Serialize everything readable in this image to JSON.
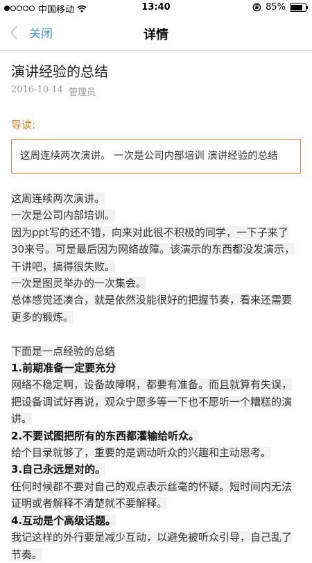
{
  "status": {
    "carrier": "中国移动",
    "time": "13:40",
    "battery": "85%"
  },
  "nav": {
    "back_label": "关闭",
    "title": "详情"
  },
  "article": {
    "title": "演讲经验的总结",
    "date": "2016-10-14",
    "author": "管理员",
    "guide_label": "导读:",
    "guide_text": "这周连续两次演讲。 一次是公司内部培训 演讲经验的总结",
    "lines": [
      {
        "text": "这周连续两次演讲。",
        "bold": false
      },
      {
        "text": "一次是公司内部培训。",
        "bold": false
      },
      {
        "text": "因为ppt写的还不错，向来对此很不积极的同学，一下子来了30来号。可是最后因为网络故障。该演示的东西都没发演示，干讲吧，搞得很失败。",
        "bold": false
      },
      {
        "text": "一次是图灵举办的一次集会。",
        "bold": false
      },
      {
        "text": "总体感觉还凑合，就是依然没能很好的把握节奏，看来还需要更多的锻炼。",
        "bold": false
      },
      {
        "text": "",
        "bold": false
      },
      {
        "text": "下面是一点经验的总结",
        "bold": false
      },
      {
        "text": "1.前期准备一定要充分",
        "bold": true
      },
      {
        "text": "网络不稳定啊，设备故障啊，都要有准备。而且就算有失误，把设备调试好再说，观众宁愿多等一下也不愿听一个糟糕的演讲。",
        "bold": false
      },
      {
        "text": "2.不要试图把所有的东西都灌输给听众。",
        "bold": true
      },
      {
        "text": "给个目录就够了，重要的是调动听众的兴趣和主动思考。",
        "bold": false
      },
      {
        "text": "3.自己永远是对的。",
        "bold": true
      },
      {
        "text": "任何时候都不要对自己的观点表示丝毫的怀疑。短时间内无法证明或者解释不清楚就不要解释。",
        "bold": false
      },
      {
        "text": "4.互动是个高级话题。",
        "bold": true
      },
      {
        "text": "我记这样的外行要是减少互动，以避免被听众引导，自己乱了节奏。",
        "bold": false
      }
    ]
  }
}
